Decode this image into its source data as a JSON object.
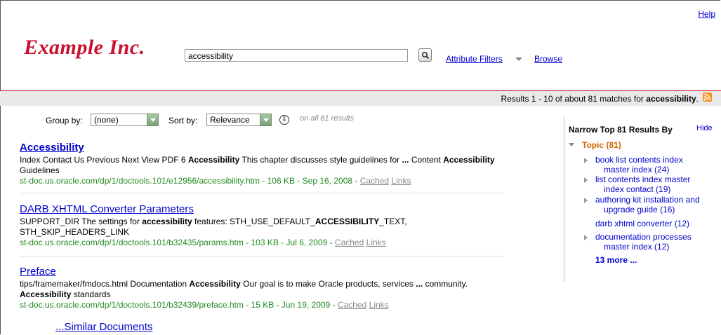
{
  "header": {
    "help_label": "Help",
    "logo_text": "Example Inc.",
    "search_value": "accessibility",
    "attribute_filters_label": "Attribute Filters",
    "browse_label": "Browse"
  },
  "results_bar": {
    "prefix": "Results 1 - 10 of about 81 matches for ",
    "query": "accessibility",
    "suffix": "."
  },
  "controls": {
    "group_by_label": "Group by:",
    "group_by_value": "(none)",
    "sort_by_label": "Sort by:",
    "sort_by_value": "Relevance",
    "on_all_text": "on all 81 results"
  },
  "results": [
    {
      "title": "Accessibility",
      "snippet_parts": [
        {
          "t": "Index Contact Us Previous Next View PDF 6 ",
          "b": false
        },
        {
          "t": "Accessibility",
          "b": true
        },
        {
          "t": " This chapter discusses style guidelines for ",
          "b": false
        },
        {
          "t": "...",
          "b": true
        },
        {
          "t": " Content ",
          "b": false
        },
        {
          "t": "Accessibility",
          "b": true
        },
        {
          "t": " Guidelines",
          "b": false
        }
      ],
      "url": "st-doc.us.oracle.com/dp/1/doctools.101/e12956/accessibility.htm - 106 KB - Sep 16, 2008 - ",
      "cached": "Cached",
      "links": "Links"
    },
    {
      "title": "DARB XHTML Converter Parameters",
      "snippet_parts": [
        {
          "t": "SUPPORT_DIR The settings for ",
          "b": false
        },
        {
          "t": "accessibility",
          "b": true
        },
        {
          "t": " features: STH_USE_DEFAULT_",
          "b": false
        },
        {
          "t": "ACCESSIBILITY",
          "b": true
        },
        {
          "t": "_TEXT, STH_SKIP_HEADERS_LINK",
          "b": false
        }
      ],
      "url": "st-doc.us.oracle.com/dp/1/doctools.101/b32435/params.htm - 103 KB - Jul 6, 2009 - ",
      "cached": "Cached",
      "links": "Links"
    },
    {
      "title": "Preface",
      "snippet_parts": [
        {
          "t": "tips/framemaker/fmdocs.html Documentation ",
          "b": false
        },
        {
          "t": "Accessibility",
          "b": true
        },
        {
          "t": " Our goal is to make Oracle products, services ",
          "b": false
        },
        {
          "t": "...",
          "b": true
        },
        {
          "t": " community. ",
          "b": false
        },
        {
          "t": "Accessibility",
          "b": true
        },
        {
          "t": " standards",
          "b": false
        }
      ],
      "url": "st-doc.us.oracle.com/dp/1/doctools.101/b32439/preface.htm - 15 KB - Jun 19, 2009 - ",
      "cached": "Cached",
      "links": "Links"
    }
  ],
  "similar_label": "...Similar Documents",
  "sidebar": {
    "title": "Narrow Top 81 Results By",
    "hide_label": "Hide",
    "topic_label": "Topic (81)",
    "facets": [
      {
        "line1": "book list contents index",
        "line2": "master index (24)",
        "has_arrow": true
      },
      {
        "line1": "list contents index master",
        "line2": "index contact (19)",
        "has_arrow": true
      },
      {
        "line1": "authoring kit installation and",
        "line2": "upgrade guide (16)",
        "has_arrow": true
      },
      {
        "line1": "darb xhtml converter (12)",
        "line2": "",
        "has_arrow": false
      },
      {
        "line1": "documentation processes",
        "line2": "master index (12)",
        "has_arrow": true
      }
    ],
    "more_label": "13 more ..."
  }
}
